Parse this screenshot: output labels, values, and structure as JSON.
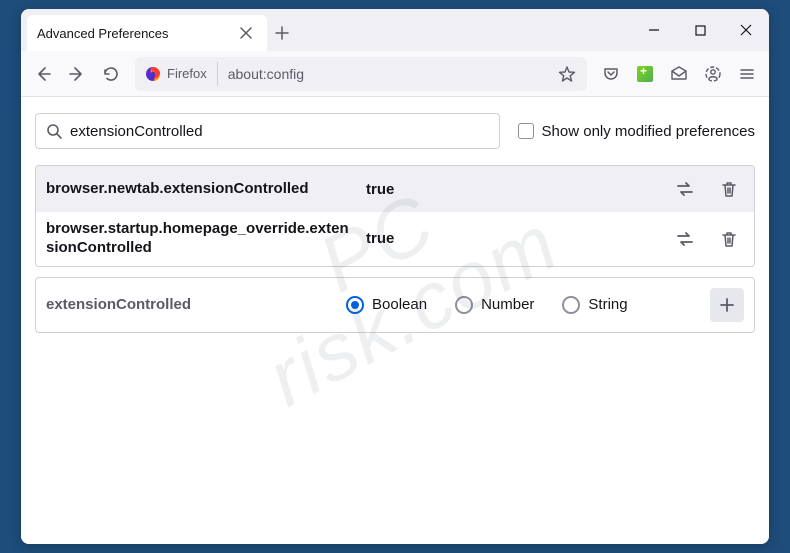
{
  "window": {
    "tab_title": "Advanced Preferences",
    "urlbar_identity": "Firefox",
    "url": "about:config"
  },
  "content": {
    "search_value": "extensionControlled",
    "show_modified_label": "Show only modified preferences",
    "show_modified_checked": false,
    "prefs": [
      {
        "name": "browser.newtab.extensionControlled",
        "value": "true"
      },
      {
        "name": "browser.startup.homepage_override.extensionControlled",
        "value": "true"
      }
    ],
    "new_pref": {
      "name": "extensionControlled",
      "types": [
        "Boolean",
        "Number",
        "String"
      ],
      "selected_type": "Boolean"
    }
  },
  "watermark": {
    "line1": "PC",
    "line2": "risk.com"
  }
}
